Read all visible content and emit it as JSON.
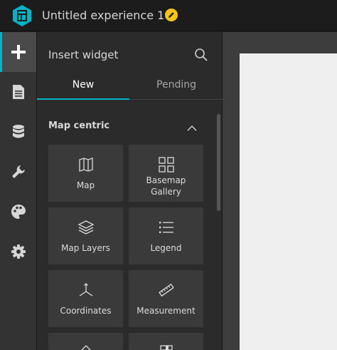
{
  "app": {
    "title": "Untitled experience 1",
    "accent": "#00b4c8",
    "edit_badge_color": "#f5c518"
  },
  "rail": [
    {
      "icon": "plus-icon",
      "active": true
    },
    {
      "icon": "page-icon",
      "active": false
    },
    {
      "icon": "database-icon",
      "active": false
    },
    {
      "icon": "wrench-icon",
      "active": false
    },
    {
      "icon": "palette-icon",
      "active": false
    },
    {
      "icon": "gear-icon",
      "active": false
    }
  ],
  "panel": {
    "title": "Insert widget",
    "tabs": [
      {
        "label": "New",
        "selected": true
      },
      {
        "label": "Pending",
        "selected": false
      }
    ],
    "section": {
      "title": "Map centric",
      "expanded": true
    },
    "widgets": [
      {
        "label": "Map",
        "icon": "map-icon"
      },
      {
        "label": "Basemap\nGallery",
        "icon": "grid-icon"
      },
      {
        "label": "Map Layers",
        "icon": "layers-icon"
      },
      {
        "label": "Legend",
        "icon": "list-icon"
      },
      {
        "label": "Coordinates",
        "icon": "axes-icon"
      },
      {
        "label": "Measurement",
        "icon": "ruler-icon"
      }
    ]
  }
}
